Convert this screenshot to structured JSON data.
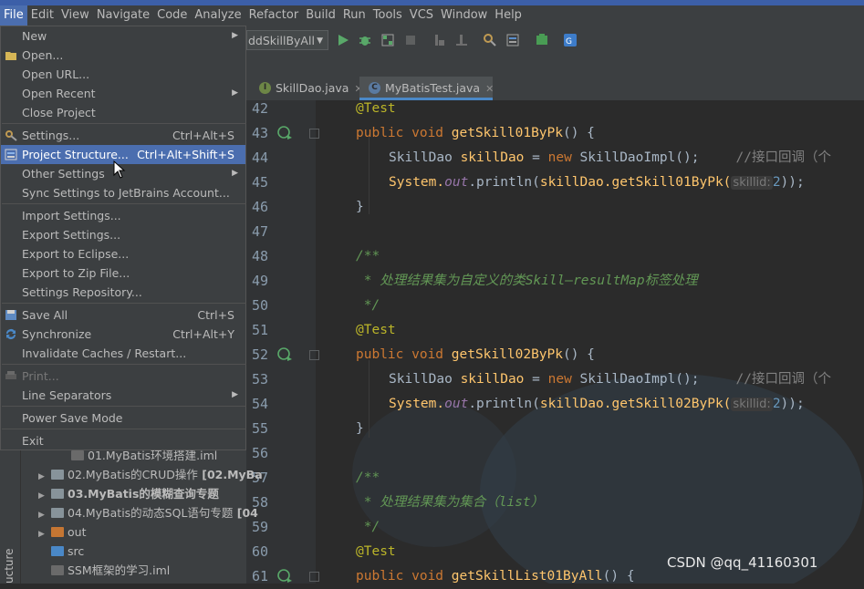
{
  "menubar": [
    "File",
    "Edit",
    "View",
    "Navigate",
    "Code",
    "Analyze",
    "Refactor",
    "Build",
    "Run",
    "Tools",
    "VCS",
    "Window",
    "Help"
  ],
  "toolbar": {
    "run_config": "ddSkillByAll"
  },
  "tabs": [
    {
      "label": "SkillDao.java"
    },
    {
      "label": "MyBatisTest.java"
    }
  ],
  "file_menu": [
    {
      "label": "New",
      "submenu": true
    },
    {
      "label": "Open...",
      "icon": "folder-icon"
    },
    {
      "label": "Open URL..."
    },
    {
      "label": "Open Recent",
      "submenu": true
    },
    {
      "label": "Close Project"
    },
    {
      "label": "Settings...",
      "shortcut": "Ctrl+Alt+S",
      "icon": "wrench-icon"
    },
    {
      "label": "Project Structure...",
      "shortcut": "Ctrl+Alt+Shift+S",
      "icon": "project-structure-icon",
      "selected": true
    },
    {
      "label": "Other Settings",
      "submenu": true
    },
    {
      "label": "Sync Settings to JetBrains Account..."
    },
    {
      "label": "Import Settings..."
    },
    {
      "label": "Export Settings..."
    },
    {
      "label": "Export to Eclipse..."
    },
    {
      "label": "Export to Zip File..."
    },
    {
      "label": "Settings Repository..."
    },
    {
      "label": "Save All",
      "shortcut": "Ctrl+S",
      "icon": "save-icon"
    },
    {
      "label": "Synchronize",
      "shortcut": "Ctrl+Alt+Y",
      "icon": "sync-icon"
    },
    {
      "label": "Invalidate Caches / Restart..."
    },
    {
      "label": "Print...",
      "disabled": true,
      "icon": "print-icon"
    },
    {
      "label": "Line Separators",
      "submenu": true
    },
    {
      "label": "Power Save Mode"
    },
    {
      "label": "Exit"
    }
  ],
  "tree": [
    {
      "label": "01.MyBatis环境搭建.iml"
    },
    {
      "label": "02.MyBatis的CRUD操作",
      "bold": " [02.MyBa"
    },
    {
      "label": "03.MyBatis的模糊查询专题",
      "bold": ""
    },
    {
      "label": "04.MyBatis的动态SQL语句专题",
      "bold": " [04"
    },
    {
      "label": "out"
    },
    {
      "label": "src"
    },
    {
      "label": "SSM框架的学习.iml"
    }
  ],
  "left_strip_label": "ucture",
  "line_numbers": [
    "42",
    "43",
    "44",
    "45",
    "46",
    "47",
    "48",
    "49",
    "50",
    "51",
    "52",
    "53",
    "54",
    "55",
    "56",
    "57",
    "58",
    "59",
    "60",
    "61"
  ],
  "code": {
    "l42_ann": "@Test",
    "l43_kw": "public void ",
    "l43_fn": "getSkill01ByPk",
    "l43_rest": "() {",
    "l44_cls": "SkillDao ",
    "l44_var": "skillDao",
    "l44_eq": " = ",
    "l44_new": "new ",
    "l44_impl": "SkillDaoImpl();",
    "l44_cm": "//接口回调（个",
    "l45_sys": "System.",
    "l45_out": "out",
    "l45_p": ".println(",
    "l45_var": "skillDao",
    "l45_call": ".getSkill01ByPk(",
    "l45_hint": "skillid:",
    "l45_num": "2",
    "l45_end": "));",
    "l46": "}",
    "l48": "/**",
    "l49": " * 处理结果集为自定义的类Skill—resultMap标签处理",
    "l50": " */",
    "l51_ann": "@Test",
    "l52_kw": "public void ",
    "l52_fn": "getSkill02ByPk",
    "l52_rest": "() {",
    "l53_cls": "SkillDao ",
    "l53_var": "skillDao",
    "l53_eq": " = ",
    "l53_new": "new ",
    "l53_impl": "SkillDaoImpl();",
    "l53_cm": "//接口回调（个",
    "l54_sys": "System.",
    "l54_out": "out",
    "l54_p": ".println(",
    "l54_var": "skillDao",
    "l54_call": ".getSkill02ByPk(",
    "l54_hint": "skillid:",
    "l54_num": "2",
    "l54_end": "));",
    "l55": "}",
    "l57": "/**",
    "l58": " * 处理结果集为集合（list）",
    "l59": " */",
    "l60_ann": "@Test",
    "l61_kw": "public void ",
    "l61_fn": "getSkillList01ByAll",
    "l61_rest": "() {"
  },
  "watermark": "CSDN @qq_41160301",
  "colors": {
    "menu_selected": "#4b6eaf",
    "menu_bg": "#3c3f41",
    "editor_bg": "#2b2b2b",
    "keyword": "#cc7832",
    "method": "#ffc66d",
    "annotation": "#bbb529",
    "doc_comment": "#629755"
  }
}
